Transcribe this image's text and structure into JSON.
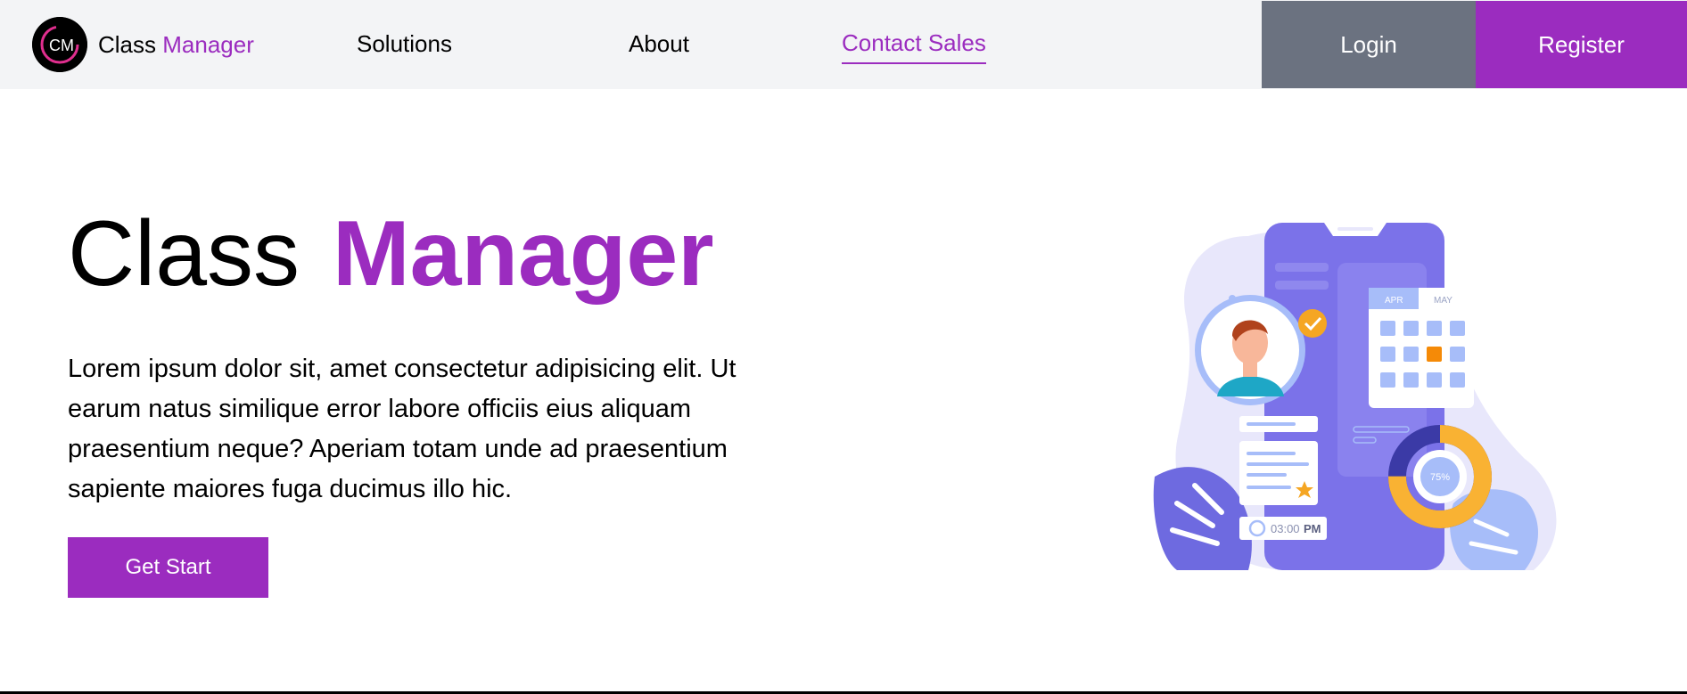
{
  "navbar": {
    "logo": {
      "text_main": "Class",
      "text_accent": "Manager",
      "mark_letters": "CM"
    },
    "links": [
      {
        "label": "Solutions"
      },
      {
        "label": "About"
      },
      {
        "label": "Contact Sales",
        "active": true
      }
    ],
    "login_label": "Login",
    "register_label": "Register"
  },
  "hero": {
    "title_main": "Class",
    "title_accent": "Manager",
    "description": "Lorem ipsum dolor sit, amet consectetur adipisicing elit. Ut earum natus similique error labore officiis eius aliquam praesentium neque? Aperiam totam unde ad praesentium sapiente maiores fuga ducimus illo hic.",
    "cta_label": "Get Start"
  },
  "illustration": {
    "calendar_months": [
      "APR",
      "MAY"
    ],
    "time_value": "03:00",
    "time_suffix": "PM",
    "progress_label": "75%",
    "progress_value": 0.75
  },
  "colors": {
    "accent": "#9b2cbf",
    "nav_bg": "#f3f4f6",
    "login_bg": "#6b7280",
    "phone": "#7b72e9"
  }
}
